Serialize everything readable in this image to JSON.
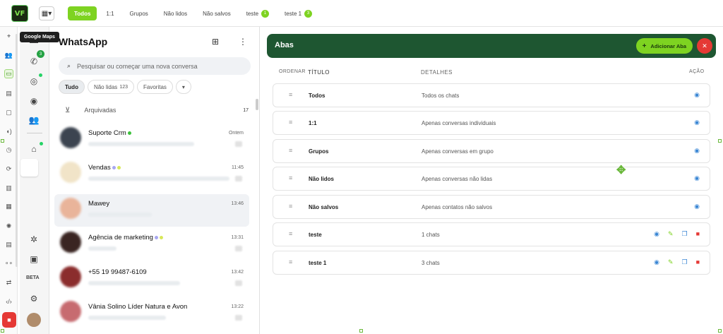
{
  "topbar": {
    "logo": "VF",
    "tabs": [
      {
        "label": "Todos",
        "active": true
      },
      {
        "label": "1:1"
      },
      {
        "label": "Grupos"
      },
      {
        "label": "Não lidos"
      },
      {
        "label": "Não salvos"
      },
      {
        "label": "teste",
        "badge": "1"
      },
      {
        "label": "teste 1",
        "badge": "3"
      }
    ]
  },
  "tooltip": "Google Maps",
  "wcol": {
    "call_badge": "3",
    "beta": "BETA"
  },
  "chats": {
    "title": "WhatsApp",
    "search_placeholder": "Pesquisar ou começar uma nova conversa",
    "filters": [
      {
        "label": "Tudo",
        "active": true
      },
      {
        "label": "Não lidas",
        "count": "123"
      },
      {
        "label": "Favoritas"
      }
    ],
    "archived_label": "Arquivadas",
    "archived_count": "17",
    "list": [
      {
        "name": "Suporte Crm",
        "time": "Ontem"
      },
      {
        "name": "Vendas",
        "time": "11:45"
      },
      {
        "name": "Mawey",
        "time": "13:46"
      },
      {
        "name": "Agência de marketing",
        "time": "13:31"
      },
      {
        "name": "+55 19 99487-6109",
        "time": "13:42"
      },
      {
        "name": "Vânia Solino Líder Natura e Avon",
        "time": "13:22"
      }
    ]
  },
  "abas": {
    "title": "Abas",
    "add_label": "Adicionar Aba",
    "headers": {
      "ordem": "ORDENAR",
      "titulo": "TÍTULO",
      "detalhes": "DETALHES",
      "acao": "AÇÃO"
    },
    "rows": [
      {
        "title": "Todos",
        "details": "Todos os chats",
        "editable": false
      },
      {
        "title": "1:1",
        "details": "Apenas conversas individuais",
        "editable": false
      },
      {
        "title": "Grupos",
        "details": "Apenas conversas em grupo",
        "editable": false
      },
      {
        "title": "Não lidos",
        "details": "Apenas conversas não lidas",
        "editable": false
      },
      {
        "title": "Não salvos",
        "details": "Apenas contatos não salvos",
        "editable": false
      },
      {
        "title": "teste",
        "details": "1 chats",
        "editable": true
      },
      {
        "title": "teste 1",
        "details": "3 chats",
        "editable": true
      }
    ]
  },
  "colors": {
    "accent": "#7ed321",
    "banner": "#1e5631",
    "danger": "#e53935",
    "link": "#3a86d4"
  }
}
